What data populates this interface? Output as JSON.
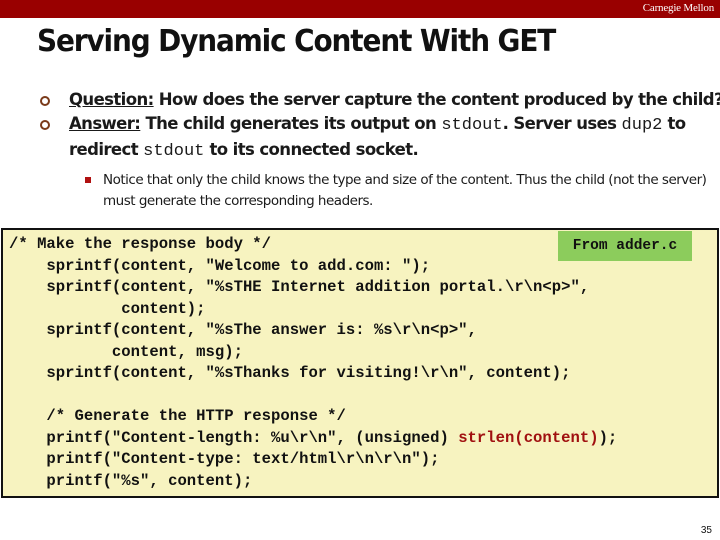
{
  "header": {
    "brand": "Carnegie Mellon",
    "bar_color": "#990000"
  },
  "slide": {
    "title": "Serving Dynamic Content With GET",
    "bullets": [
      {
        "label": "Question:",
        "text": " How does the server capture the content produced by the child?"
      },
      {
        "label": "Answer:",
        "parts": [
          " The child generates its output on ",
          "stdout",
          ".  Server uses ",
          "dup2",
          "  to redirect ",
          "stdout",
          "  to its connected socket."
        ]
      }
    ],
    "sub_bullet": "Notice that only the child knows the type and size of the content. Thus the child (not the server) must generate the corresponding headers."
  },
  "code": {
    "source_tag": "From adder.c",
    "lines": [
      "/* Make the response body */",
      "    sprintf(content, \"Welcome to add.com: \");",
      "    sprintf(content, \"%sTHE Internet addition portal.\\r\\n<p>\",",
      "            content);",
      "    sprintf(content, \"%sThe answer is: %s\\r\\n<p>\",",
      "           content, msg);",
      "    sprintf(content, \"%sThanks for visiting!\\r\\n\", content);",
      "",
      "    /* Generate the HTTP response */"
    ],
    "printf1_pre": "    printf(\"Content-length: %u\\r\\n\", (unsigned) ",
    "printf1_highlight": "strlen(content)",
    "printf1_post": ");",
    "tail_lines": [
      "    printf(\"Content-type: text/html\\r\\n\\r\\n\");",
      "    printf(\"%s\", content);"
    ],
    "background": "#f7f3c0",
    "highlight_color": "#a01010",
    "tag_color": "#8ccc5c"
  },
  "footer": {
    "page_number": "35"
  }
}
